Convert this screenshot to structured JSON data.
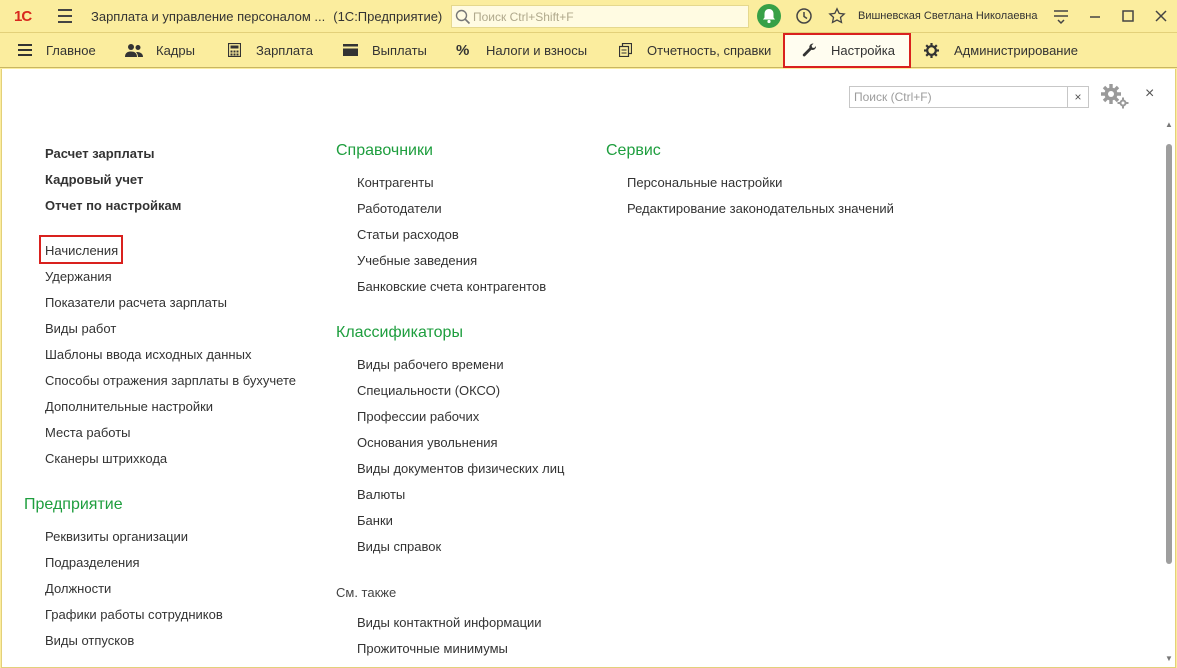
{
  "titlebar": {
    "logo": "1С",
    "window_title": "Зарплата и управление персоналом ...",
    "app_name": "(1С:Предприятие)",
    "search_placeholder": "Поиск Ctrl+Shift+F",
    "user_name": "Вишневская Светлана Николаевна"
  },
  "sections": [
    {
      "label": "Главное",
      "icon": "menu-icon"
    },
    {
      "label": "Кадры",
      "icon": "people-icon"
    },
    {
      "label": "Зарплата",
      "icon": "calculator-icon"
    },
    {
      "label": "Выплаты",
      "icon": "wallet-icon"
    },
    {
      "label": "Налоги и взносы",
      "icon": "percent-icon"
    },
    {
      "label": "Отчетность, справки",
      "icon": "documents-icon"
    },
    {
      "label": "Настройка",
      "icon": "wrench-icon",
      "active": true
    },
    {
      "label": "Администрирование",
      "icon": "gear-icon"
    }
  ],
  "panel": {
    "search_placeholder": "Поиск (Ctrl+F)",
    "clear_label": "×",
    "close_label": "×"
  },
  "col1": {
    "bold_links": [
      "Расчет зарплаты",
      "Кадровый учет",
      "Отчет по настройкам"
    ],
    "links": [
      "Начисления",
      "Удержания",
      "Показатели расчета зарплаты",
      "Виды работ",
      "Шаблоны ввода исходных данных",
      "Способы отражения зарплаты в бухучете",
      "Дополнительные настройки",
      "Места работы",
      "Сканеры штрихкода"
    ],
    "group_title": "Предприятие",
    "group_links": [
      "Реквизиты организации",
      "Подразделения",
      "Должности",
      "Графики работы сотрудников",
      "Виды отпусков"
    ]
  },
  "col2": {
    "group1_title": "Справочники",
    "group1_links": [
      "Контрагенты",
      "Работодатели",
      "Статьи расходов",
      "Учебные заведения",
      "Банковские счета контрагентов"
    ],
    "group2_title": "Классификаторы",
    "group2_links": [
      "Виды рабочего времени",
      "Специальности (ОКСО)",
      "Профессии рабочих",
      "Основания увольнения",
      "Виды документов физических лиц",
      "Валюты",
      "Банки",
      "Виды справок"
    ],
    "see_also_title": "См. также",
    "see_also_links": [
      "Виды контактной информации",
      "Прожиточные минимумы"
    ]
  },
  "col3": {
    "group_title": "Сервис",
    "group_links": [
      "Персональные настройки",
      "Редактирование законодательных значений"
    ]
  },
  "colors": {
    "accent_green": "#1e9e3e",
    "highlight_red": "#d9211e",
    "bar_yellow": "#fbed9e"
  }
}
